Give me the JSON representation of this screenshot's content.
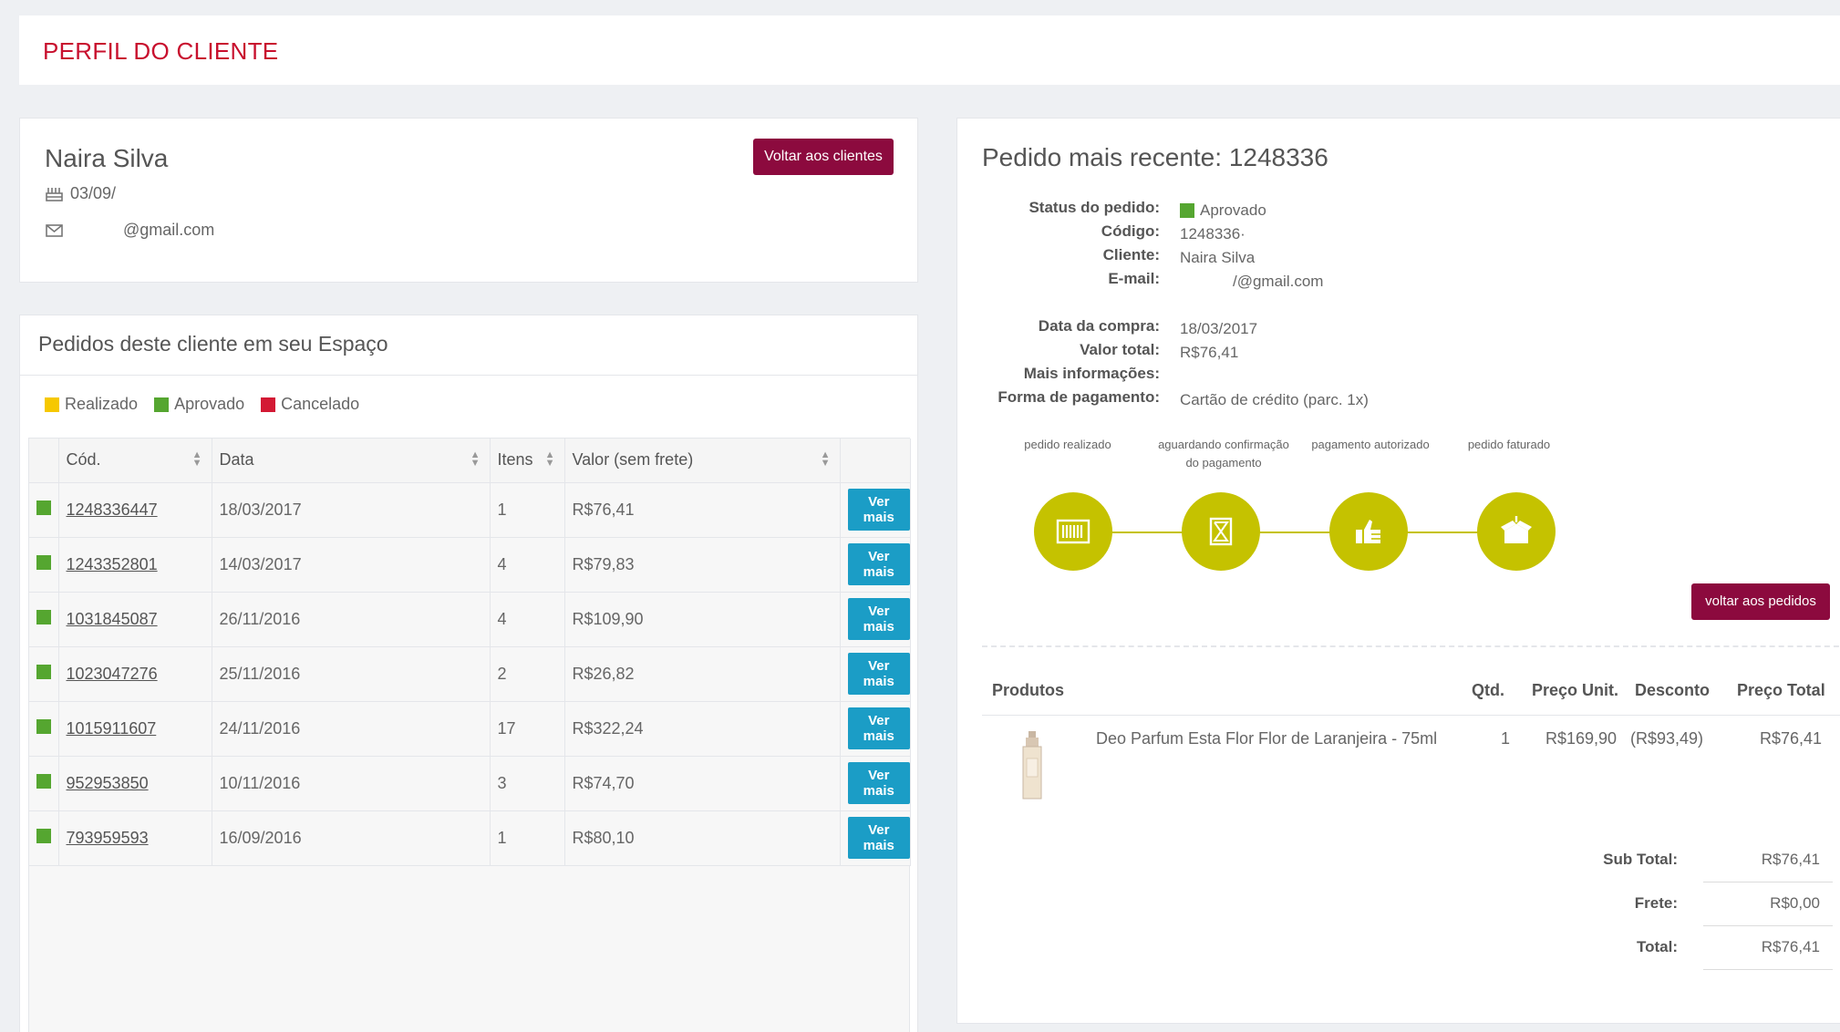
{
  "header": {
    "title": "PERFIL DO CLIENTE"
  },
  "client": {
    "name": "Naira Silva",
    "birthday": "03/09/",
    "email": "@gmail.com",
    "back_button": "Voltar aos clientes"
  },
  "orders": {
    "title": "Pedidos deste cliente em seu Espaço",
    "legend": [
      {
        "label": "Realizado",
        "color": "#f6c800"
      },
      {
        "label": "Aprovado",
        "color": "#55a630"
      },
      {
        "label": "Cancelado",
        "color": "#d31934"
      }
    ],
    "columns": [
      "Cód.",
      "Data",
      "Itens",
      "Valor (sem frete)"
    ],
    "rows": [
      {
        "code": "1248336447",
        "date": "18/03/2017",
        "items": "1",
        "value": "R$76,41",
        "action": "Ver mais"
      },
      {
        "code": "1243352801",
        "date": "14/03/2017",
        "items": "4",
        "value": "R$79,83",
        "action": "Ver mais"
      },
      {
        "code": "1031845087",
        "date": "26/11/2016",
        "items": "4",
        "value": "R$109,90",
        "action": "Ver mais"
      },
      {
        "code": "1023047276",
        "date": "25/11/2016",
        "items": "2",
        "value": "R$26,82",
        "action": "Ver mais"
      },
      {
        "code": "1015911607",
        "date": "24/11/2016",
        "items": "17",
        "value": "R$322,24",
        "action": "Ver mais"
      },
      {
        "code": "952953850",
        "date": "10/11/2016",
        "items": "3",
        "value": "R$74,70",
        "action": "Ver mais"
      },
      {
        "code": "793959593",
        "date": "16/09/2016",
        "items": "1",
        "value": "R$80,10",
        "action": "Ver mais"
      }
    ]
  },
  "detail": {
    "title": "Pedido mais recente: 1248336",
    "labels": {
      "status": "Status do pedido:",
      "code": "Código:",
      "client": "Cliente:",
      "email": "E-mail:",
      "date": "Data da compra:",
      "total": "Valor total:",
      "more": "Mais informações:",
      "payment": "Forma de pagamento:"
    },
    "values": {
      "status": "Aprovado",
      "code": "1248336·",
      "client": "Naira Silva",
      "email": "/@gmail.com",
      "date": "18/03/2017",
      "total": "R$76,41",
      "more": "",
      "payment": "Cartão de crédito (parc. 1x)"
    },
    "steps": [
      "pedido realizado",
      "aguardando confirmação do pagamento",
      "pagamento autorizado",
      "pedido faturado"
    ],
    "back_button": "voltar aos pedidos",
    "products_header": {
      "product": "Produtos",
      "qty": "Qtd.",
      "unit": "Preço Unit.",
      "discount": "Desconto",
      "total": "Preço Total"
    },
    "product": {
      "name": "Deo Parfum Esta Flor Flor de Laranjeira - 75ml",
      "qty": "1",
      "unit": "R$169,90",
      "discount": "(R$93,49)",
      "total": "R$76,41"
    },
    "summary": {
      "subtotal_label": "Sub Total:",
      "subtotal": "R$76,41",
      "freight_label": "Frete:",
      "freight": "R$0,00",
      "total_label": "Total:",
      "total": "R$76,41"
    }
  },
  "colors": {
    "brand": "#8c0a3e",
    "title_red": "#c8102e",
    "step_green": "#c5c200",
    "button_blue": "#1b9dc6",
    "approved": "#55a630"
  }
}
